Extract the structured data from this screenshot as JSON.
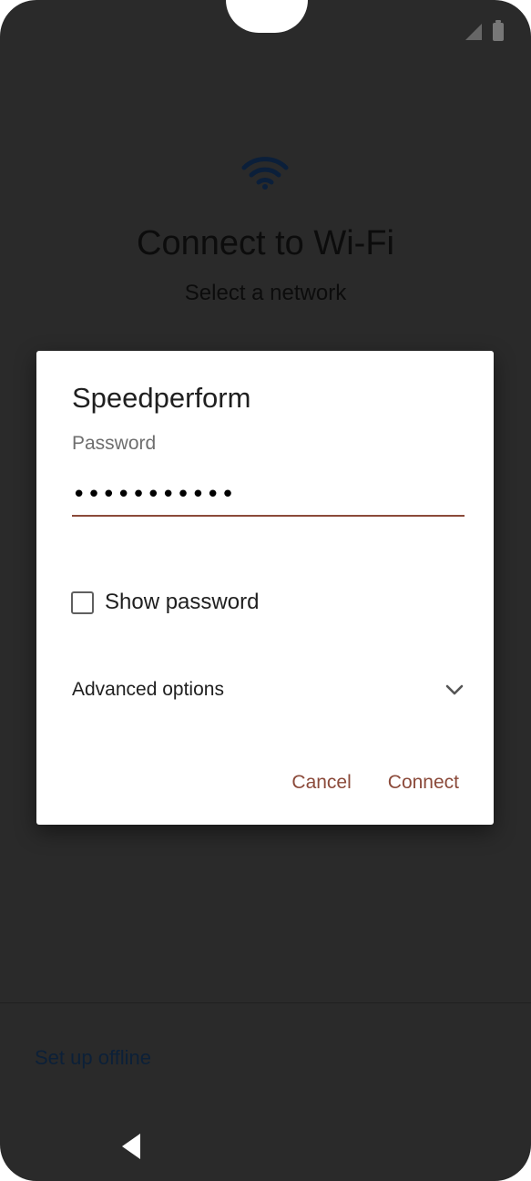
{
  "screen": {
    "title": "Connect to Wi-Fi",
    "subtitle": "Select a network",
    "offline_link": "Set up offline"
  },
  "dialog": {
    "title": "Speedperform",
    "password_label": "Password",
    "password_value": "•••••••••••",
    "show_password_label": "Show password",
    "show_password_checked": false,
    "advanced_label": "Advanced options",
    "cancel_label": "Cancel",
    "connect_label": "Connect"
  },
  "icons": {
    "wifi": "wifi-icon",
    "signal": "signal-icon",
    "battery": "battery-icon",
    "chevron": "chevron-down-icon",
    "back": "back-icon"
  },
  "colors": {
    "accent": "#8b4a3a",
    "scrim": "#2a2a2a",
    "wifi_icon": "#0b1f3a"
  }
}
